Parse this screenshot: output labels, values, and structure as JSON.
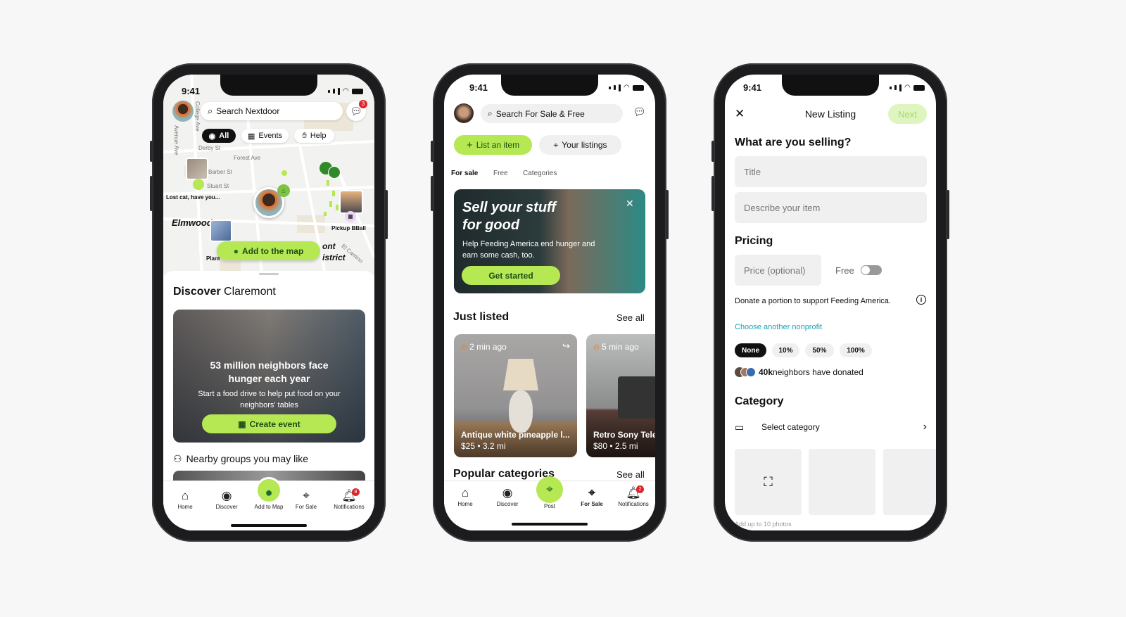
{
  "colors": {
    "accent": "#b5e853",
    "dark_green": "#1d6b2b",
    "teal_link": "#1aa3b8",
    "badge": "#e0242c"
  },
  "phone1": {
    "time": "9:41",
    "search_placeholder": "Search Nextdoor",
    "chat_badge": "3",
    "filters": [
      {
        "label": "All",
        "icon": "compass-icon"
      },
      {
        "label": "Events",
        "icon": "calendar-icon"
      },
      {
        "label": "Help",
        "icon": "hand-icon"
      }
    ],
    "map_labels": {
      "derby": "Derby St",
      "forest": "Forest Ave",
      "barber": "Barber St",
      "stuart": "Stuart St",
      "elmwood": "Elmwood",
      "district": "ont\nistrict",
      "el_camino": "El Camino",
      "college": "College Ave",
      "avenue": "Avenue Ave"
    },
    "pins": {
      "lost_cat": "Lost cat, have you...",
      "pickup": "Pickup BBall",
      "plant": "Plant"
    },
    "add_to_map": "Add to the map",
    "discover_bold": "Discover",
    "discover_place": "Claremont",
    "card": {
      "title": "53 million neighbors face hunger each year",
      "subtitle": "Start a food drive to help put food on your neighbors' tables",
      "button": "Create event"
    },
    "groups_title": "Nearby groups you may like",
    "tabs": [
      {
        "label": "Home",
        "icon": "home-icon"
      },
      {
        "label": "Discover",
        "icon": "discover-icon"
      },
      {
        "label": "Add to Map",
        "icon": "map-pin-icon"
      },
      {
        "label": "For Sale",
        "icon": "tag-icon"
      },
      {
        "label": "Notifications",
        "icon": "bell-icon",
        "badge": "8"
      }
    ]
  },
  "phone2": {
    "time": "9:41",
    "search_placeholder": "Search For Sale & Free",
    "list_item": "List an item",
    "your_listings": "Your listings",
    "subtabs": [
      "For sale",
      "Free",
      "Categories"
    ],
    "banner": {
      "title1": "Sell your stuff",
      "title2": "for good",
      "text": "Help Feeding America end hunger and earn some cash, too.",
      "button": "Get started"
    },
    "just_listed": "Just listed",
    "see_all": "See all",
    "listings": [
      {
        "time": "2 min ago",
        "title": "Antique white pineapple l...",
        "meta": "$25 • 3.2 mi"
      },
      {
        "time": "5 min ago",
        "title": "Retro Sony Tele",
        "meta": "$80 • 2.5 mi"
      }
    ],
    "popular": "Popular categories",
    "tabs": [
      {
        "label": "Home",
        "icon": "home-icon"
      },
      {
        "label": "Discover",
        "icon": "discover-icon"
      },
      {
        "label": "Post",
        "icon": "post-icon"
      },
      {
        "label": "For Sale",
        "icon": "tag-icon"
      },
      {
        "label": "Notifications",
        "icon": "bell-icon",
        "badge": "2"
      }
    ]
  },
  "phone3": {
    "time": "9:41",
    "title": "New Listing",
    "next": "Next",
    "question": "What are you selling?",
    "title_placeholder": "Title",
    "describe_placeholder": "Describe your item",
    "pricing": "Pricing",
    "price_placeholder": "Price (optional)",
    "free_label": "Free",
    "free_on": false,
    "donate_text": "Donate a portion to support ",
    "donate_org": "Feeding America.",
    "choose_nonprofit": "Choose another nonprofit",
    "donate_options": [
      "None",
      "10%",
      "50%",
      "100%"
    ],
    "donate_selected": "None",
    "donated_count": "40k",
    "donated_text": " neighbors have donated",
    "category": "Category",
    "select_category": "Select category",
    "photos_hint": "Add up to 10 photos"
  }
}
